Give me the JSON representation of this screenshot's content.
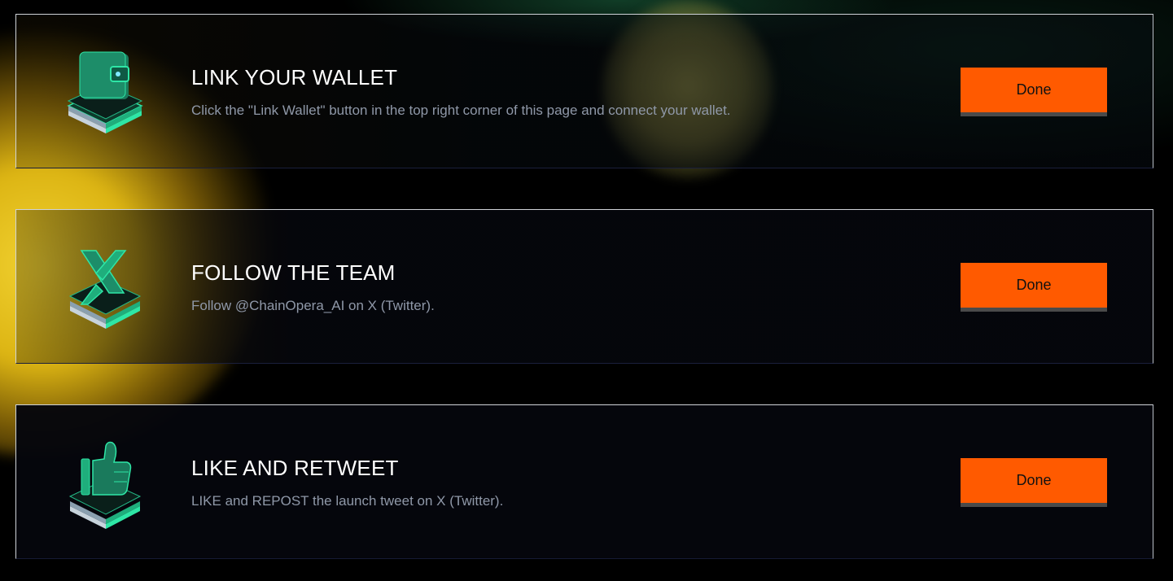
{
  "tasks": [
    {
      "title": "LINK YOUR WALLET",
      "description": "Click the \"Link Wallet\" button in the top right corner of this page and connect your wallet.",
      "icon": "wallet-icon",
      "button_label": "Done"
    },
    {
      "title": "FOLLOW THE TEAM",
      "description": "Follow @ChainOpera_AI on X (Twitter).",
      "icon": "x-logo-icon",
      "button_label": "Done"
    },
    {
      "title": "LIKE AND RETWEET",
      "description": "LIKE and REPOST the launch tweet on X (Twitter).",
      "icon": "thumbs-up-icon",
      "button_label": "Done"
    }
  ],
  "colors": {
    "accent_button": "#ff5a00",
    "icon_green": "#2ee6a6",
    "title_text": "#ffffff",
    "desc_text": "#8f98a8"
  }
}
